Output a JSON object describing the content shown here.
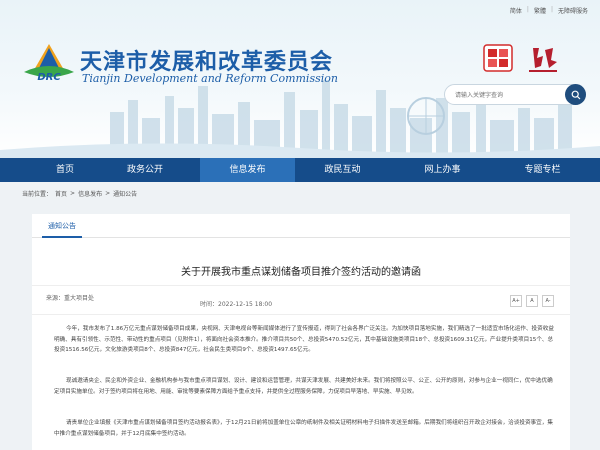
{
  "toplinks": [
    "简体",
    "繁體",
    "无障碍服务"
  ],
  "site": {
    "title_cn": "天津市发展和改革委员会",
    "title_en": "Tianjin Development and Reform Commission",
    "logo_text": "DRC"
  },
  "search": {
    "placeholder": "请输入关键字查询"
  },
  "nav": [
    "首页",
    "政务公开",
    "信息发布",
    "政民互动",
    "网上办事",
    "专题专栏"
  ],
  "breadcrumb": {
    "label": "当前位置：",
    "items": [
      "首页",
      "信息发布",
      "通知公告"
    ],
    "sep": ">"
  },
  "tab": "通知公告",
  "article": {
    "title": "关于开展我市重点谋划储备项目推介签约活动的邀请函",
    "source": "来源：重大项目处",
    "time": "时间：2022-12-15 18:00",
    "font_controls": [
      "A+",
      "A",
      "A-"
    ],
    "paragraphs": [
      "今年，我市发布了1.86万亿元重点谋划储备项目成果，央视网、天津电视台等新闻媒体进行了宣传报道，得到了社会各界广泛关注。为加快项目落地实施，我们精选了一批适宜市场化运作、投资收益明确、具有引领性、示范性、带动性的重点项目（见附件1），将面向社会资本推介。推介项目共50个、总投资5470.52亿元，其中基础设施类项目18个、总投资1609.31亿元，产业提升类项目15个、总投资1516.56亿元，文化旅游类项目8个、总投资847亿元，社会民生类项目9个、总投资1497.65亿元。",
      "现诚邀请央企、民企和外资企业、金融机构参与我市重点项目谋划、设计、建设和运营管理，共谋天津发展、共建美好未来。我们将按照公平、公正、公开的原则，对参与企业一视同仁，优中选优确定项目实施单位。对于签约项目将在用地、用能、审批等要素保障方面给予重点支持，并提供全过程服务保障，力促项目早落地、早实施、早见效。",
      "请贵单位企业填报《天津市重点谋划储备项目签约活动报名表》，于12月21日前将加盖单位公章的纸制件及相关证明材料电子扫描件发送至邮箱。后期我们将组织召开政企对接会，洽谈投资事宜，集中推介重点谋划储备项目，并于12月底集中签约活动。"
    ]
  },
  "colors": {
    "nav": "#154c8a",
    "nav_active": "#2b70b8",
    "brand": "#1d5ea8",
    "seal_red": "#d22b2b"
  }
}
